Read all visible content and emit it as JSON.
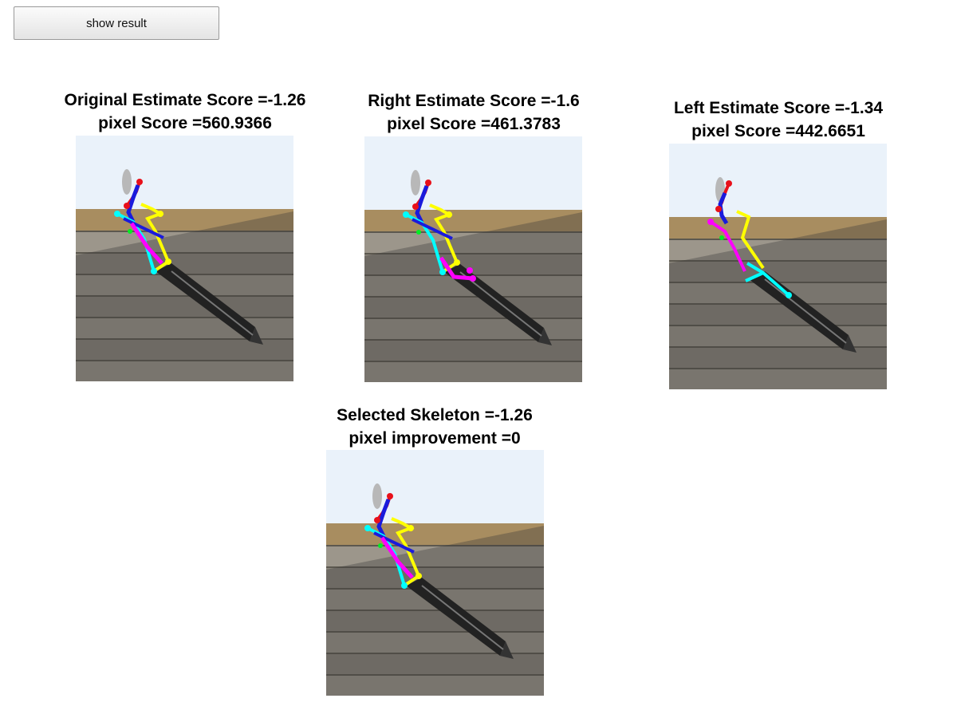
{
  "controls": {
    "show_result_label": "show result"
  },
  "panels": {
    "original": {
      "line1": "Original Estimate Score =-1.26",
      "line2": "pixel Score =560.9366"
    },
    "right": {
      "line1": "Right Estimate Score =-1.6",
      "line2": "pixel Score =461.3783"
    },
    "left": {
      "line1": "Left Estimate Score =-1.34",
      "line2": "pixel Score =442.6651"
    },
    "selected": {
      "line1": "Selected Skeleton =-1.26",
      "line2": "pixel improvement =0"
    }
  },
  "colors": {
    "head": "#e8101a",
    "torso": "#1a1adc",
    "left_arm": "#ffff00",
    "right_arm": "#00ffff",
    "leg_left": "#ff00ff",
    "leg_right": "#00ee22",
    "sky": "#eaf2fa",
    "wall": "#a88d60",
    "stone": "#8f8a80"
  }
}
